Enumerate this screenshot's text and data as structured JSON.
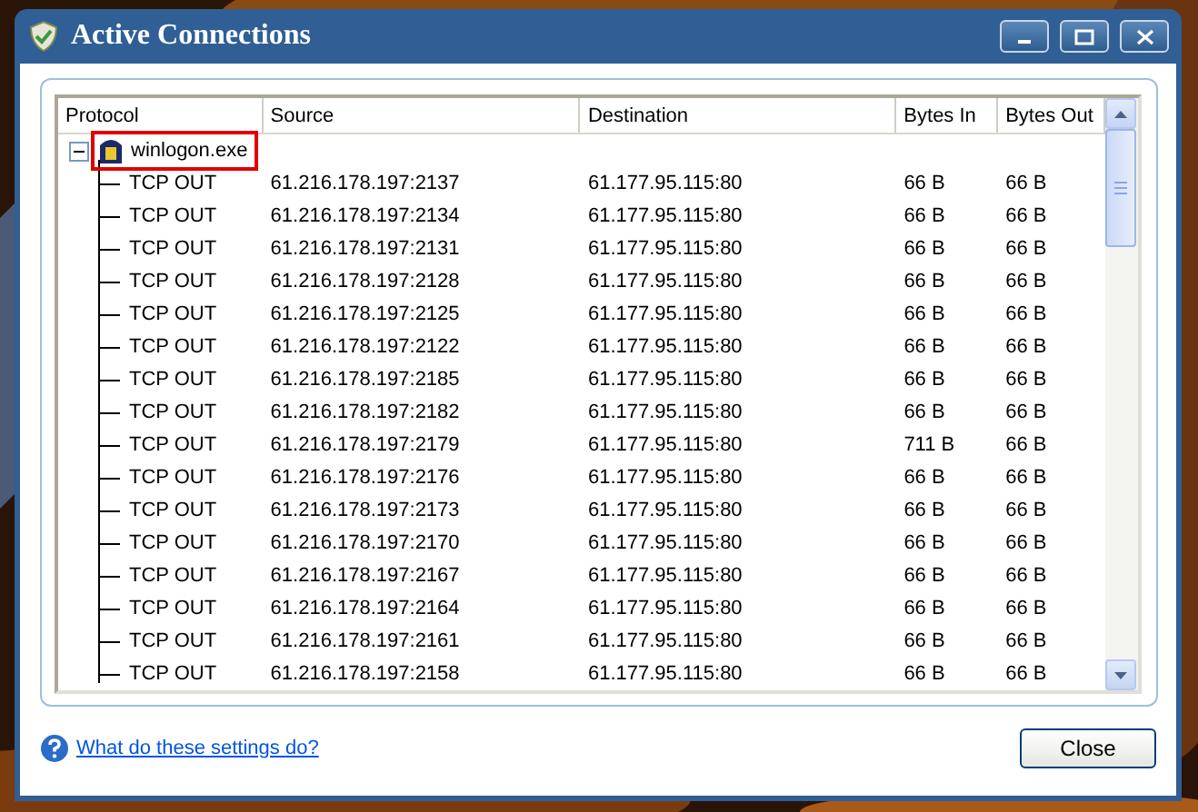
{
  "window": {
    "title": "Active Connections"
  },
  "columns": [
    "Protocol",
    "Source",
    "Destination",
    "Bytes In",
    "Bytes Out"
  ],
  "process": {
    "name": "winlogon.exe",
    "expanded": true,
    "highlighted": true,
    "children": [
      {
        "protocol": "TCP OUT",
        "source": "61.216.178.197:2137",
        "destination": "61.177.95.115:80",
        "bytes_in": "66 B",
        "bytes_out": "66 B"
      },
      {
        "protocol": "TCP OUT",
        "source": "61.216.178.197:2134",
        "destination": "61.177.95.115:80",
        "bytes_in": "66 B",
        "bytes_out": "66 B"
      },
      {
        "protocol": "TCP OUT",
        "source": "61.216.178.197:2131",
        "destination": "61.177.95.115:80",
        "bytes_in": "66 B",
        "bytes_out": "66 B"
      },
      {
        "protocol": "TCP OUT",
        "source": "61.216.178.197:2128",
        "destination": "61.177.95.115:80",
        "bytes_in": "66 B",
        "bytes_out": "66 B"
      },
      {
        "protocol": "TCP OUT",
        "source": "61.216.178.197:2125",
        "destination": "61.177.95.115:80",
        "bytes_in": "66 B",
        "bytes_out": "66 B"
      },
      {
        "protocol": "TCP OUT",
        "source": "61.216.178.197:2122",
        "destination": "61.177.95.115:80",
        "bytes_in": "66 B",
        "bytes_out": "66 B"
      },
      {
        "protocol": "TCP OUT",
        "source": "61.216.178.197:2185",
        "destination": "61.177.95.115:80",
        "bytes_in": "66 B",
        "bytes_out": "66 B"
      },
      {
        "protocol": "TCP OUT",
        "source": "61.216.178.197:2182",
        "destination": "61.177.95.115:80",
        "bytes_in": "66 B",
        "bytes_out": "66 B"
      },
      {
        "protocol": "TCP OUT",
        "source": "61.216.178.197:2179",
        "destination": "61.177.95.115:80",
        "bytes_in": "711 B",
        "bytes_out": "66 B"
      },
      {
        "protocol": "TCP OUT",
        "source": "61.216.178.197:2176",
        "destination": "61.177.95.115:80",
        "bytes_in": "66 B",
        "bytes_out": "66 B"
      },
      {
        "protocol": "TCP OUT",
        "source": "61.216.178.197:2173",
        "destination": "61.177.95.115:80",
        "bytes_in": "66 B",
        "bytes_out": "66 B"
      },
      {
        "protocol": "TCP OUT",
        "source": "61.216.178.197:2170",
        "destination": "61.177.95.115:80",
        "bytes_in": "66 B",
        "bytes_out": "66 B"
      },
      {
        "protocol": "TCP OUT",
        "source": "61.216.178.197:2167",
        "destination": "61.177.95.115:80",
        "bytes_in": "66 B",
        "bytes_out": "66 B"
      },
      {
        "protocol": "TCP OUT",
        "source": "61.216.178.197:2164",
        "destination": "61.177.95.115:80",
        "bytes_in": "66 B",
        "bytes_out": "66 B"
      },
      {
        "protocol": "TCP OUT",
        "source": "61.216.178.197:2161",
        "destination": "61.177.95.115:80",
        "bytes_in": "66 B",
        "bytes_out": "66 B"
      },
      {
        "protocol": "TCP OUT",
        "source": "61.216.178.197:2158",
        "destination": "61.177.95.115:80",
        "bytes_in": "66 B",
        "bytes_out": "66 B"
      }
    ]
  },
  "help_link": "What do these settings do?",
  "buttons": [
    "Close"
  ]
}
